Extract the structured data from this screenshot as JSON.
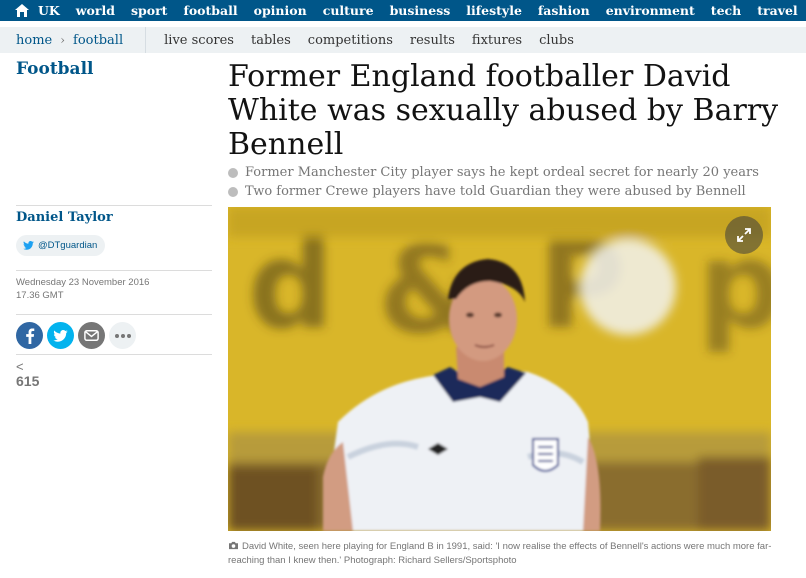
{
  "topnav": {
    "home_icon": "home-icon",
    "items": [
      "UK",
      "world",
      "sport",
      "football",
      "opinion",
      "culture",
      "business",
      "lifestyle",
      "fashion",
      "environment",
      "tech",
      "travel"
    ]
  },
  "subnav": {
    "breadcrumb": [
      "home",
      "football"
    ],
    "items": [
      "live scores",
      "tables",
      "competitions",
      "results",
      "fixtures",
      "clubs"
    ]
  },
  "article": {
    "section": "Football",
    "headline": "Former England footballer David White was sexually abused by Barry Bennell",
    "standfirst": [
      "Former Manchester City player says he kept ordeal secret for nearly 20 years",
      "Two former Crewe players have told Guardian they were abused by Bennell"
    ],
    "author": "Daniel Taylor",
    "twitter_handle": "@DTguardian",
    "date": "Wednesday 23 November 2016",
    "time": "17.36 GMT",
    "share_count": "615",
    "share_buttons": [
      "facebook-icon",
      "twitter-icon",
      "email-icon",
      "more-icon"
    ],
    "image_caption": "David White, seen here playing for England B in 1991, said: 'I now realise the effects of Bennell's actions were much more far-reaching than I knew then.' Photograph: Richard Sellers/Sportsphoto"
  },
  "colors": {
    "nav_blue": "#005689",
    "subnav_bg": "#edf1f3",
    "facebook": "#3067a3",
    "twitter": "#03b3ee",
    "email": "#767676"
  }
}
